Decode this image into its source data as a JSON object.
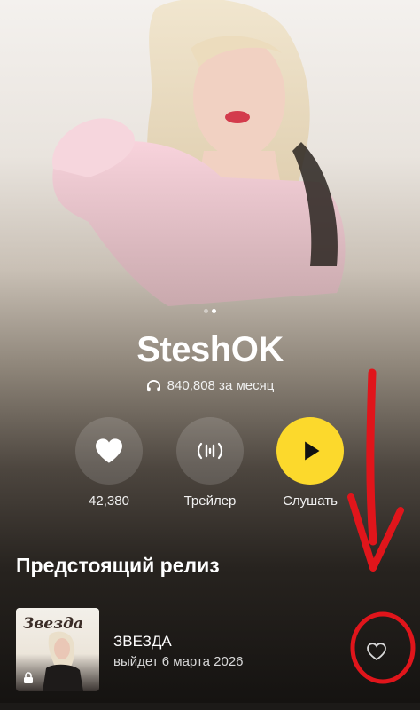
{
  "artist": {
    "name": "SteshOK",
    "monthly_listeners": "840,808 за месяц"
  },
  "carousel": {
    "pages": 2,
    "active": 2
  },
  "actions": {
    "like": {
      "label": "42,380",
      "icon": "heart-icon"
    },
    "trailer": {
      "label": "Трейлер",
      "icon": "waveform-icon"
    },
    "listen": {
      "label": "Слушать",
      "icon": "play-icon"
    }
  },
  "upcoming": {
    "section_title": "Предстоящий релиз",
    "release": {
      "cover_text": "Звезда",
      "title": "ЗВЕЗДА",
      "subtitle": "выйдет 6 марта 2026"
    }
  },
  "colors": {
    "accent_yellow": "#fcd92c",
    "annotation_red": "#e0151b"
  }
}
